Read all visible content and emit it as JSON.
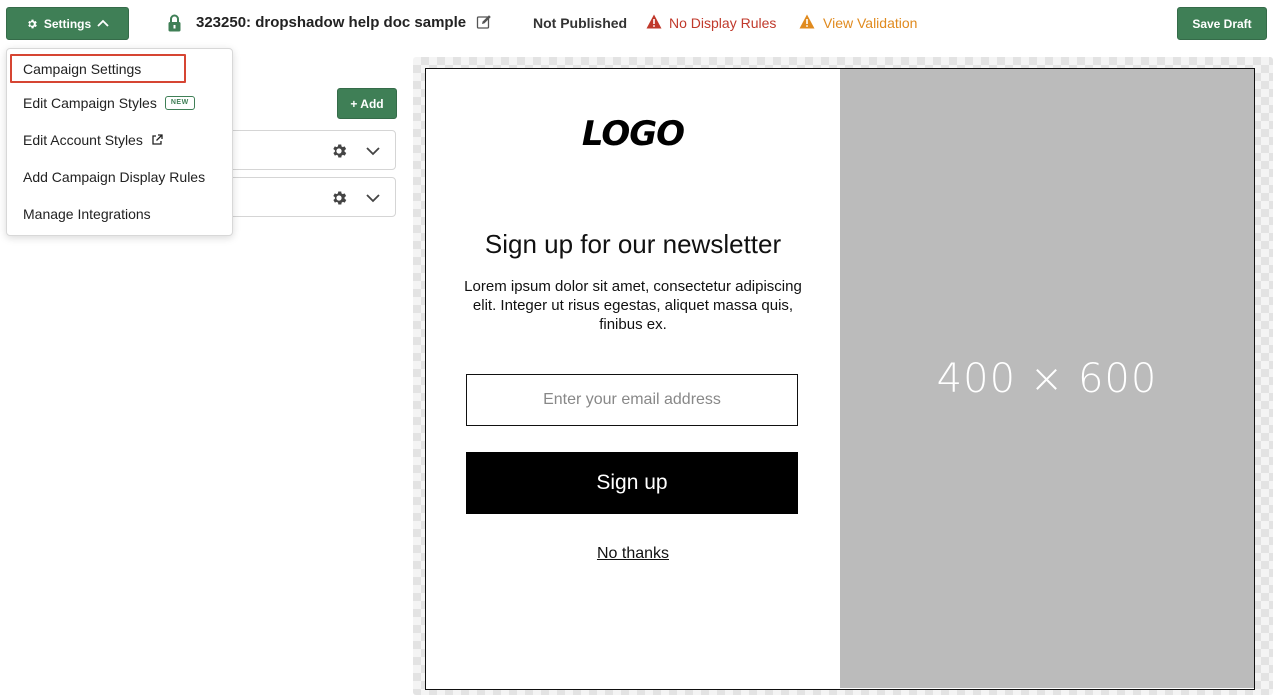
{
  "header": {
    "settings_label": "Settings",
    "campaign_title": "323250: dropshadow help doc sample",
    "publish_status": "Not Published",
    "display_rules_warning": "No Display Rules",
    "validation_warning": "View Validation",
    "save_label": "Save Draft"
  },
  "settings_menu": {
    "items": [
      {
        "label": "Campaign Settings"
      },
      {
        "label": "Edit Campaign Styles",
        "badge": "NEW"
      },
      {
        "label": "Edit Account Styles"
      },
      {
        "label": "Add Campaign Display Rules"
      },
      {
        "label": "Manage Integrations"
      }
    ]
  },
  "left_panel": {
    "add_label": "+ Add"
  },
  "preview": {
    "logo_text": "LOGO",
    "headline": "Sign up for our newsletter",
    "body": "Lorem ipsum dolor sit amet, consectetur adipiscing elit. Integer ut risus egestas, aliquet massa quis, finibus ex.",
    "email_placeholder": "Enter your email address",
    "signup_label": "Sign up",
    "decline_label": "No thanks",
    "image_placeholder": "400 × 600"
  },
  "colors": {
    "primary_green": "#3f7f56",
    "error_red": "#c0392b",
    "warning_orange": "#e08a1e",
    "highlight_border": "#d64533"
  },
  "icons": {
    "settings": "gear-icon",
    "caret": "chevron-up-icon",
    "lock": "lock-icon",
    "edit": "pencil-icon",
    "warning": "warning-triangle-icon",
    "external": "external-link-icon",
    "row_settings": "gear-icon",
    "row_expand": "chevron-down-icon"
  }
}
